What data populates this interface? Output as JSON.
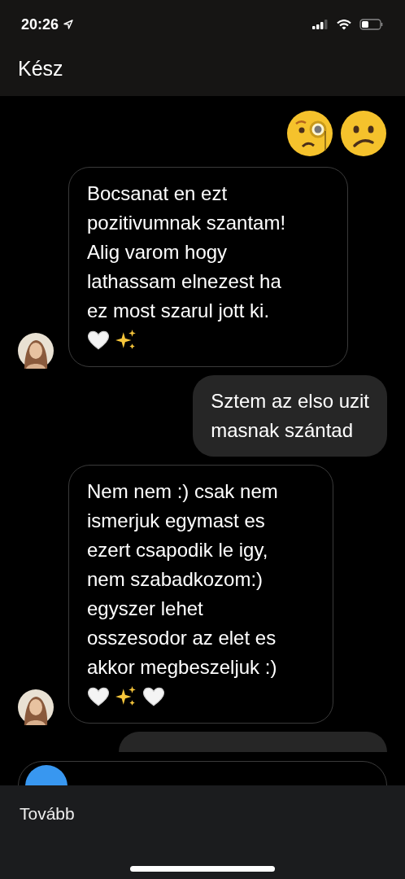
{
  "status_bar": {
    "time": "20:26"
  },
  "header": {
    "done_button": "Kész"
  },
  "reactions": [
    {
      "kind": "monocle-face"
    },
    {
      "kind": "confused-face"
    }
  ],
  "messages": [
    {
      "kind": "incoming",
      "text": "Bocsanat en ezt\npozitivumnak szantam!\nAlig varom hogy\nlathassam elnezest ha\nez most szarul jott ki.",
      "emoji": [
        {
          "kind": "white-heart"
        },
        {
          "kind": "sparkles"
        }
      ]
    },
    {
      "kind": "outgoing",
      "text": "Sztem az elso uzit\nmasnak szántad"
    },
    {
      "kind": "incoming",
      "text": "Nem nem :) csak nem\nismerjuk egymast es\nezert csapodik le igy,\nnem szabadkozom:)\negyszer lehet\nosszesodor az elet es\nakkor megbeszeljuk :)",
      "emoji": [
        {
          "kind": "white-heart"
        },
        {
          "kind": "sparkles"
        },
        {
          "kind": "white-heart"
        }
      ]
    }
  ],
  "action_sheet": {
    "button": "Tovább"
  }
}
